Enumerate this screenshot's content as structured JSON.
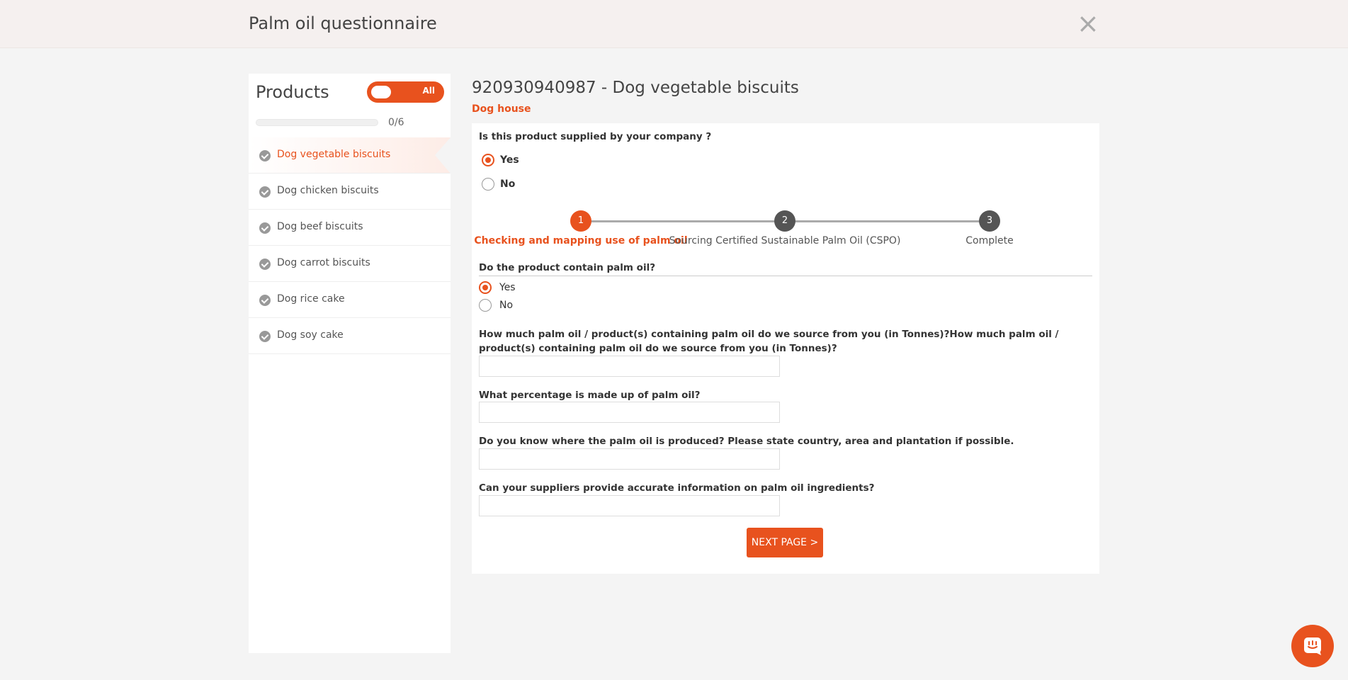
{
  "header": {
    "title": "Palm oil questionnaire",
    "close_icon": "close-icon"
  },
  "sidebar": {
    "title": "Products",
    "toggle_label": "All",
    "progress_text": "0/6",
    "progress_fraction": 0,
    "items": [
      {
        "label": "Dog vegetable biscuits",
        "active": true
      },
      {
        "label": "Dog chicken biscuits",
        "active": false
      },
      {
        "label": "Dog beef biscuits",
        "active": false
      },
      {
        "label": "Dog carrot biscuits",
        "active": false
      },
      {
        "label": "Dog rice cake",
        "active": false
      },
      {
        "label": "Dog soy cake",
        "active": false
      }
    ]
  },
  "main": {
    "title": "920930940987 - Dog vegetable biscuits",
    "subtitle": "Dog house",
    "supplied_question": "Is this product supplied by your company ?",
    "supplied_options": [
      "Yes",
      "No"
    ],
    "supplied_selected": "Yes",
    "steps": [
      {
        "number": "1",
        "label": "Checking and mapping use of palm oil",
        "active": true
      },
      {
        "number": "2",
        "label": "Sourcing Certified Sustainable Palm Oil (CSPO)",
        "active": false
      },
      {
        "number": "3",
        "label": "Complete",
        "active": false
      }
    ],
    "contain_question": "Do the product contain palm oil?",
    "contain_options": [
      "Yes",
      "No"
    ],
    "contain_selected": "Yes",
    "questions": [
      {
        "label": "How much palm oil / product(s) containing palm oil do we source from you (in Tonnes)?How much palm oil / product(s) containing palm oil do we source from you (in Tonnes)?",
        "value": ""
      },
      {
        "label": "What percentage is made up of palm oil?",
        "value": ""
      },
      {
        "label": "Do you know where the palm oil is produced? Please state country, area and plantation if possible.",
        "value": ""
      },
      {
        "label": "Can your suppliers provide accurate information on palm oil ingredients?",
        "value": ""
      }
    ],
    "next_button": "NEXT PAGE >"
  },
  "colors": {
    "accent": "#e8521e",
    "header_bg": "#f5f0ef",
    "page_bg": "#f4f4f4"
  },
  "chat_icon": "chat-icon"
}
